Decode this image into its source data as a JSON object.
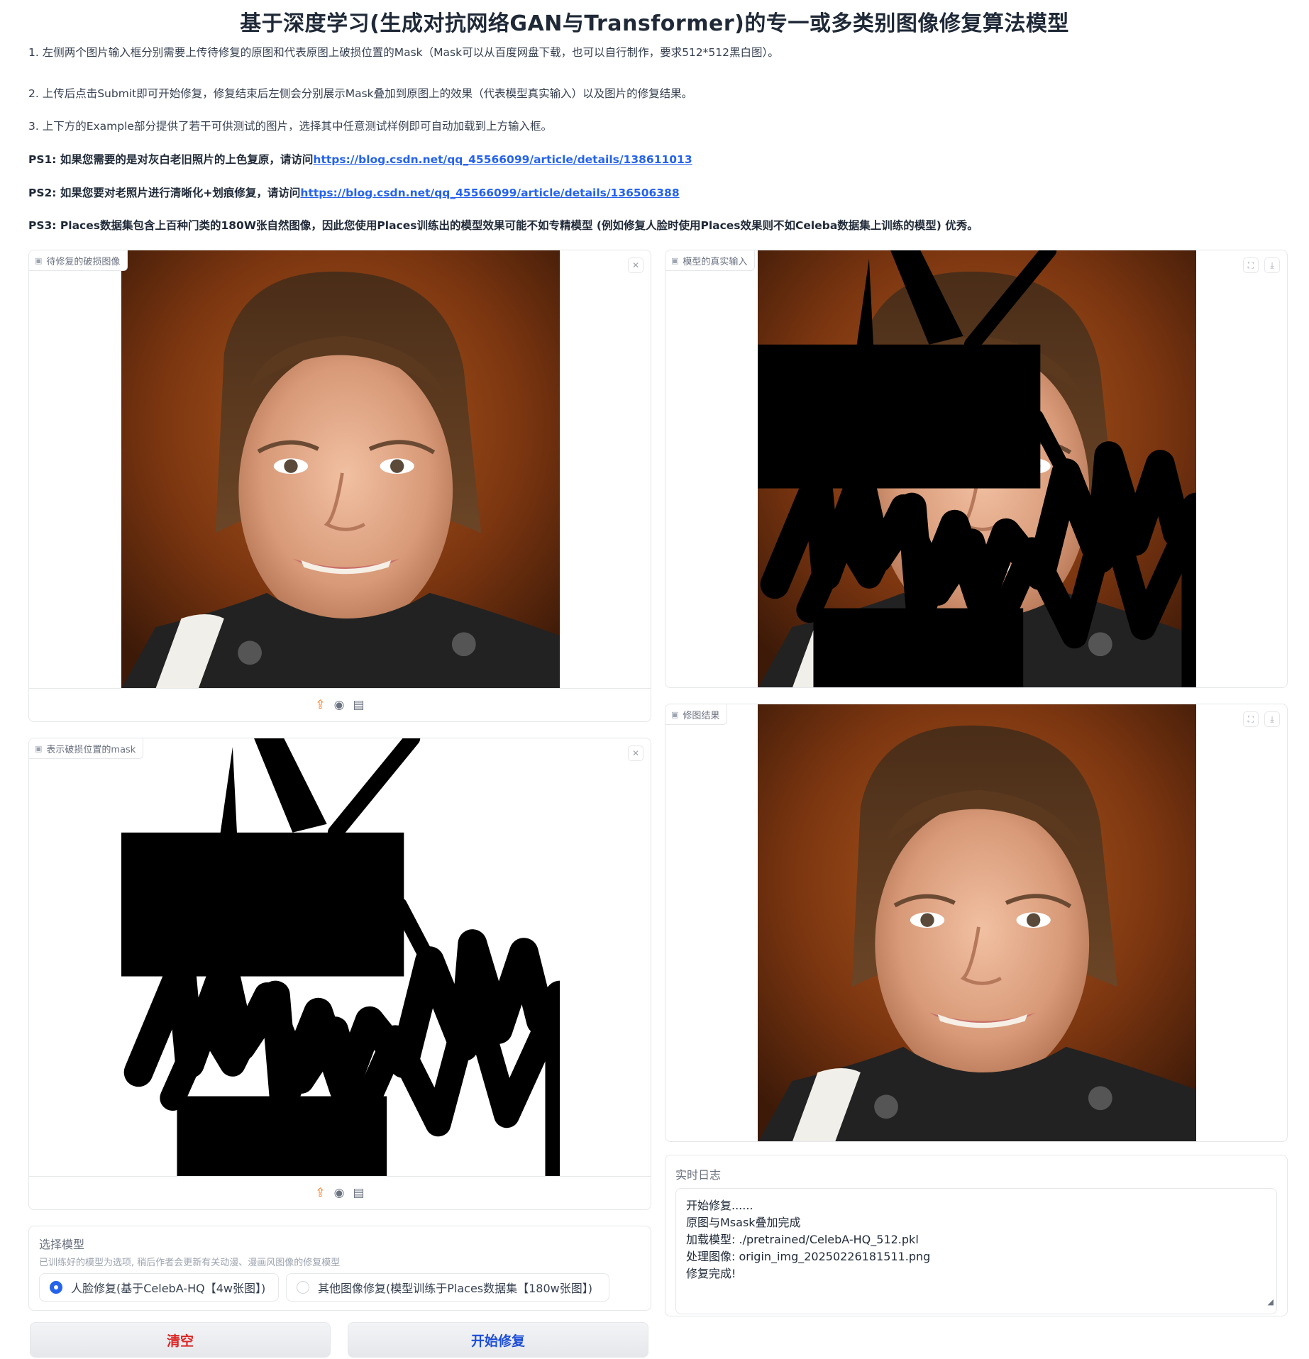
{
  "header": {
    "title": "基于深度学习(生成对抗网络GAN与Transformer)的专一或多类别图像修复算法模型"
  },
  "instructions": {
    "line1": "1. 左侧两个图片输入框分别需要上传待修复的原图和代表原图上破损位置的Mask（Mask可以从百度网盘下载，也可以自行制作，要求512*512黑白图）。",
    "line2": "2. 上传后点击Submit即可开始修复，修复结束后左侧会分别展示Mask叠加到原图上的效果（代表模型真实输入）以及图片的修复结果。",
    "line3": "3. 上下方的Example部分提供了若干可供测试的图片，选择其中任意测试样例即可自动加载到上方输入框。",
    "ps1_text": "PS1: 如果您需要的是对灰白老旧照片的上色复原，请访问",
    "ps1_link": "https://blog.csdn.net/qq_45566099/article/details/138611013",
    "ps2_text": "PS2: 如果您要对老照片进行清晰化+划痕修复，请访问",
    "ps2_link": "https://blog.csdn.net/qq_45566099/article/details/136506388",
    "ps3": "PS3: Places数据集包含上百种门类的180W张自然图像，因此您使用Places训练出的模型效果可能不如专精模型 (例如修复人脸时使用Places效果则不如Celeba数据集上训练的模型) 优秀。"
  },
  "panels": {
    "damaged_label": "待修复的破损图像",
    "mask_label": "表示破损位置的mask",
    "model_input_label": "模型的真实输入",
    "result_label": "修图结果"
  },
  "model_select": {
    "title": "选择模型",
    "info": "已训练好的模型为选项, 稍后作者会更新有关动漫、漫画风图像的修复模型",
    "options": [
      {
        "label": "人脸修复(基于CelebA-HQ【4w张图】)",
        "selected": true
      },
      {
        "label": "其他图像修复(模型训练于Places数据集【180w张图】)",
        "selected": false
      }
    ]
  },
  "buttons": {
    "clear": "清空",
    "start": "开始修复"
  },
  "log": {
    "title": "实时日志",
    "lines": [
      "开始修复......",
      "原图与Msask叠加完成",
      "加载模型: ./pretrained/CelebA-HQ_512.pkl",
      "处理图像: origin_img_20250226181511.png",
      "修复完成!"
    ]
  },
  "icons": {
    "image": "image-icon",
    "close": "close-icon",
    "fullscreen": "fullscreen-icon",
    "download": "download-icon",
    "upload": "upload-icon",
    "webcam": "webcam-icon",
    "clipboard": "clipboard-icon"
  },
  "colors": {
    "clear_button_text": "#dc2626",
    "start_button_text": "#1d4ed8",
    "link": "#2563eb",
    "radio_accent": "#2563eb",
    "upload_icon": "#f97316"
  }
}
